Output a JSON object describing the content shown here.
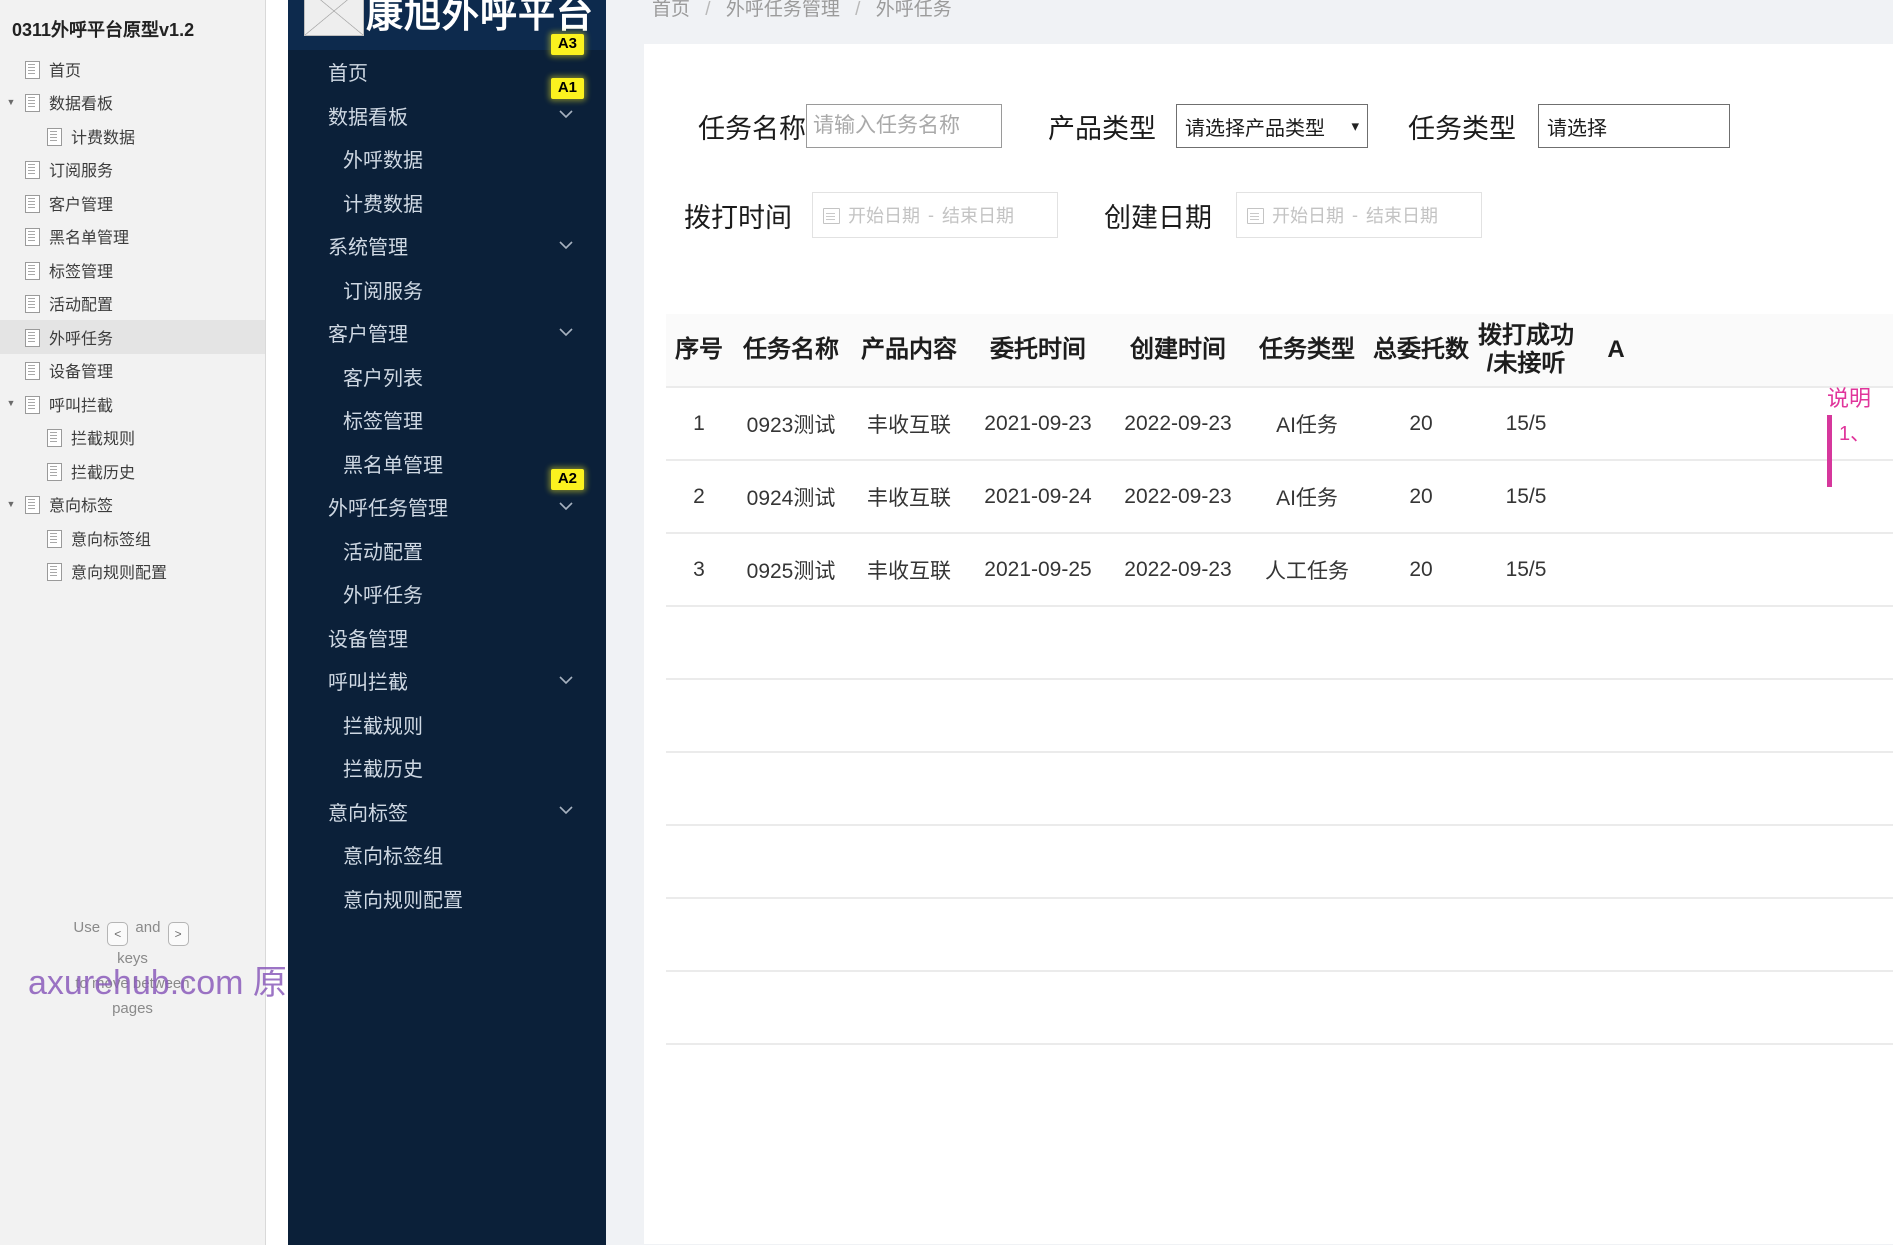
{
  "sitemap": {
    "title": "0311外呼平台原型v1.2",
    "items": [
      {
        "label": "首页",
        "depth": 0,
        "arrow": false,
        "selected": false
      },
      {
        "label": "数据看板",
        "depth": 0,
        "arrow": true,
        "selected": false
      },
      {
        "label": "计费数据",
        "depth": 1,
        "arrow": false,
        "selected": false
      },
      {
        "label": "订阅服务",
        "depth": 0,
        "arrow": false,
        "selected": false
      },
      {
        "label": "客户管理",
        "depth": 0,
        "arrow": false,
        "selected": false
      },
      {
        "label": "黑名单管理",
        "depth": 0,
        "arrow": false,
        "selected": false
      },
      {
        "label": "标签管理",
        "depth": 0,
        "arrow": false,
        "selected": false
      },
      {
        "label": "活动配置",
        "depth": 0,
        "arrow": false,
        "selected": false
      },
      {
        "label": "外呼任务",
        "depth": 0,
        "arrow": false,
        "selected": true
      },
      {
        "label": "设备管理",
        "depth": 0,
        "arrow": false,
        "selected": false
      },
      {
        "label": "呼叫拦截",
        "depth": 0,
        "arrow": true,
        "selected": false
      },
      {
        "label": "拦截规则",
        "depth": 1,
        "arrow": false,
        "selected": false
      },
      {
        "label": "拦截历史",
        "depth": 1,
        "arrow": false,
        "selected": false
      },
      {
        "label": "意向标签",
        "depth": 0,
        "arrow": true,
        "selected": false
      },
      {
        "label": "意向标签组",
        "depth": 1,
        "arrow": false,
        "selected": false
      },
      {
        "label": "意向规则配置",
        "depth": 1,
        "arrow": false,
        "selected": false
      }
    ],
    "hint": {
      "use": "Use",
      "key_prev": "<",
      "and": "and",
      "key_next": ">",
      "line2": "keys",
      "line3": "to move between",
      "line4": "pages"
    }
  },
  "watermark": "axurehub.com 原型资源站",
  "appnav": {
    "logo_text": "康旭外呼平台",
    "logo_icon": "image-placeholder-icon",
    "items": [
      {
        "label": "首页",
        "level": 1,
        "chevron": false,
        "badge": "A3"
      },
      {
        "label": "数据看板",
        "level": 1,
        "chevron": true,
        "badge": "A1"
      },
      {
        "label": "外呼数据",
        "level": 2,
        "chevron": false,
        "badge": ""
      },
      {
        "label": "计费数据",
        "level": 2,
        "chevron": false,
        "badge": ""
      },
      {
        "label": "系统管理",
        "level": 1,
        "chevron": true,
        "badge": ""
      },
      {
        "label": "订阅服务",
        "level": 2,
        "chevron": false,
        "badge": ""
      },
      {
        "label": "客户管理",
        "level": 1,
        "chevron": true,
        "badge": ""
      },
      {
        "label": "客户列表",
        "level": 2,
        "chevron": false,
        "badge": ""
      },
      {
        "label": "标签管理",
        "level": 2,
        "chevron": false,
        "badge": ""
      },
      {
        "label": "黑名单管理",
        "level": 2,
        "chevron": false,
        "badge": ""
      },
      {
        "label": "外呼任务管理",
        "level": 1,
        "chevron": true,
        "badge": "A2"
      },
      {
        "label": "活动配置",
        "level": 2,
        "chevron": false,
        "badge": ""
      },
      {
        "label": "外呼任务",
        "level": 2,
        "chevron": false,
        "badge": ""
      },
      {
        "label": "设备管理",
        "level": 1,
        "chevron": false,
        "badge": ""
      },
      {
        "label": "呼叫拦截",
        "level": 1,
        "chevron": true,
        "badge": ""
      },
      {
        "label": "拦截规则",
        "level": 2,
        "chevron": false,
        "badge": ""
      },
      {
        "label": "拦截历史",
        "level": 2,
        "chevron": false,
        "badge": ""
      },
      {
        "label": "意向标签",
        "level": 1,
        "chevron": true,
        "badge": ""
      },
      {
        "label": "意向标签组",
        "level": 2,
        "chevron": false,
        "badge": ""
      },
      {
        "label": "意向规则配置",
        "level": 2,
        "chevron": false,
        "badge": ""
      }
    ]
  },
  "breadcrumb": {
    "item1": "首页",
    "item2": "外呼任务管理",
    "item3": "外呼任务",
    "separator": "/"
  },
  "filters": {
    "task_name": {
      "label": "任务名称",
      "value": "",
      "placeholder": "请输入任务名称"
    },
    "product_type": {
      "label": "产品类型",
      "selected": "请选择产品类型",
      "caret": "chevron-down-icon"
    },
    "task_type": {
      "label": "任务类型",
      "selected": "请选择"
    },
    "call_time": {
      "label": "拨打时间",
      "start_placeholder": "开始日期",
      "dash": "-",
      "end_placeholder": "结束日期",
      "icon": "calendar-icon"
    },
    "create_date": {
      "label": "创建日期",
      "start_placeholder": "开始日期",
      "dash": "-",
      "end_placeholder": "结束日期",
      "icon": "calendar-icon"
    }
  },
  "table": {
    "columns": [
      "序号",
      "任务名称",
      "产品内容",
      "委托时间",
      "创建时间",
      "任务类型",
      "总委托数",
      "拨打成功\n/未接听",
      "A"
    ],
    "rows": [
      {
        "index": "1",
        "task_name": "0923测试",
        "product": "丰收互联",
        "entrust_time": "2021-09-23",
        "create_time": "2022-09-23",
        "task_type": "AI任务",
        "total": "20",
        "success_missed": "15/5",
        "extra": ""
      },
      {
        "index": "2",
        "task_name": "0924测试",
        "product": "丰收互联",
        "entrust_time": "2021-09-24",
        "create_time": "2022-09-23",
        "task_type": "AI任务",
        "total": "20",
        "success_missed": "15/5",
        "extra": ""
      },
      {
        "index": "3",
        "task_name": "0925测试",
        "product": "丰收互联",
        "entrust_time": "2021-09-25",
        "create_time": "2022-09-23",
        "task_type": "人工任务",
        "total": "20",
        "success_missed": "15/5",
        "extra": ""
      }
    ]
  },
  "annotation": {
    "title": "说明",
    "line1": "1、",
    "color": "#e0359b"
  }
}
